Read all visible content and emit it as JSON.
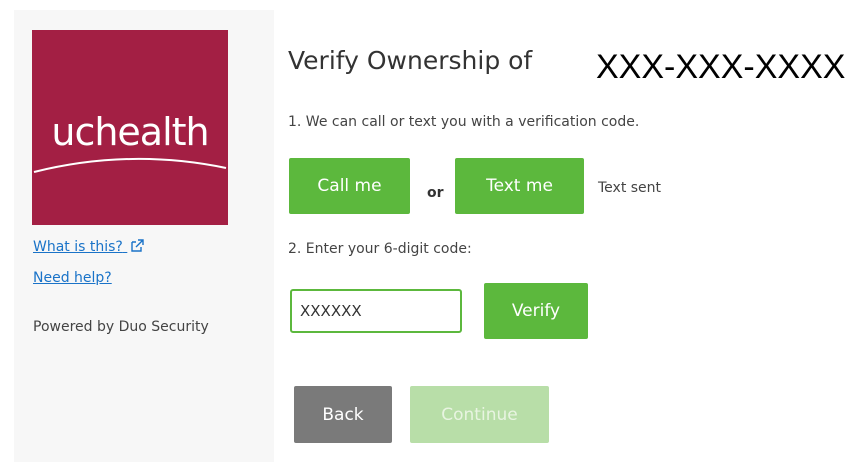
{
  "sidebar": {
    "logo_text": "uchealth",
    "what_is_this_label": "What is this?",
    "need_help_label": "Need help?",
    "powered_by": "Powered by Duo Security"
  },
  "main": {
    "title": "Verify Ownership of",
    "phone_masked": "XXX-XXX-XXXX",
    "step1_text": "1. We can call or text you with a verification code.",
    "call_button_label": "Call me",
    "or_label": "or",
    "text_button_label": "Text me",
    "status_text": "Text sent",
    "step2_text": "2. Enter your 6-digit code:",
    "code_value": "XXXXXX",
    "verify_button_label": "Verify",
    "back_button_label": "Back",
    "continue_button_label": "Continue"
  },
  "colors": {
    "brand": "#a31f44",
    "accent_green": "#5cb83d",
    "disabled_green": "#b8dea8",
    "back_gray": "#7a7a7a",
    "link_blue": "#1a73c8"
  },
  "icons": {
    "external_link": "external-link-icon"
  }
}
